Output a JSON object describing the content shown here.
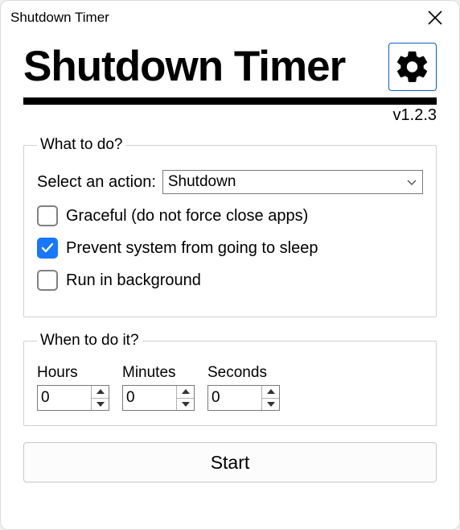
{
  "window": {
    "title": "Shutdown Timer"
  },
  "header": {
    "app_title": "Shutdown Timer",
    "version": "v1.2.3"
  },
  "what": {
    "legend": "What to do?",
    "select_label": "Select an action:",
    "selected_action": "Shutdown",
    "graceful": {
      "label": "Graceful (do not force close apps)",
      "checked": false
    },
    "prevent_sleep": {
      "label": "Prevent system from going to sleep",
      "checked": true
    },
    "run_background": {
      "label": "Run in background",
      "checked": false
    }
  },
  "when": {
    "legend": "When to do it?",
    "hours_label": "Hours",
    "minutes_label": "Minutes",
    "seconds_label": "Seconds",
    "hours": "0",
    "minutes": "0",
    "seconds": "0"
  },
  "start_label": "Start"
}
